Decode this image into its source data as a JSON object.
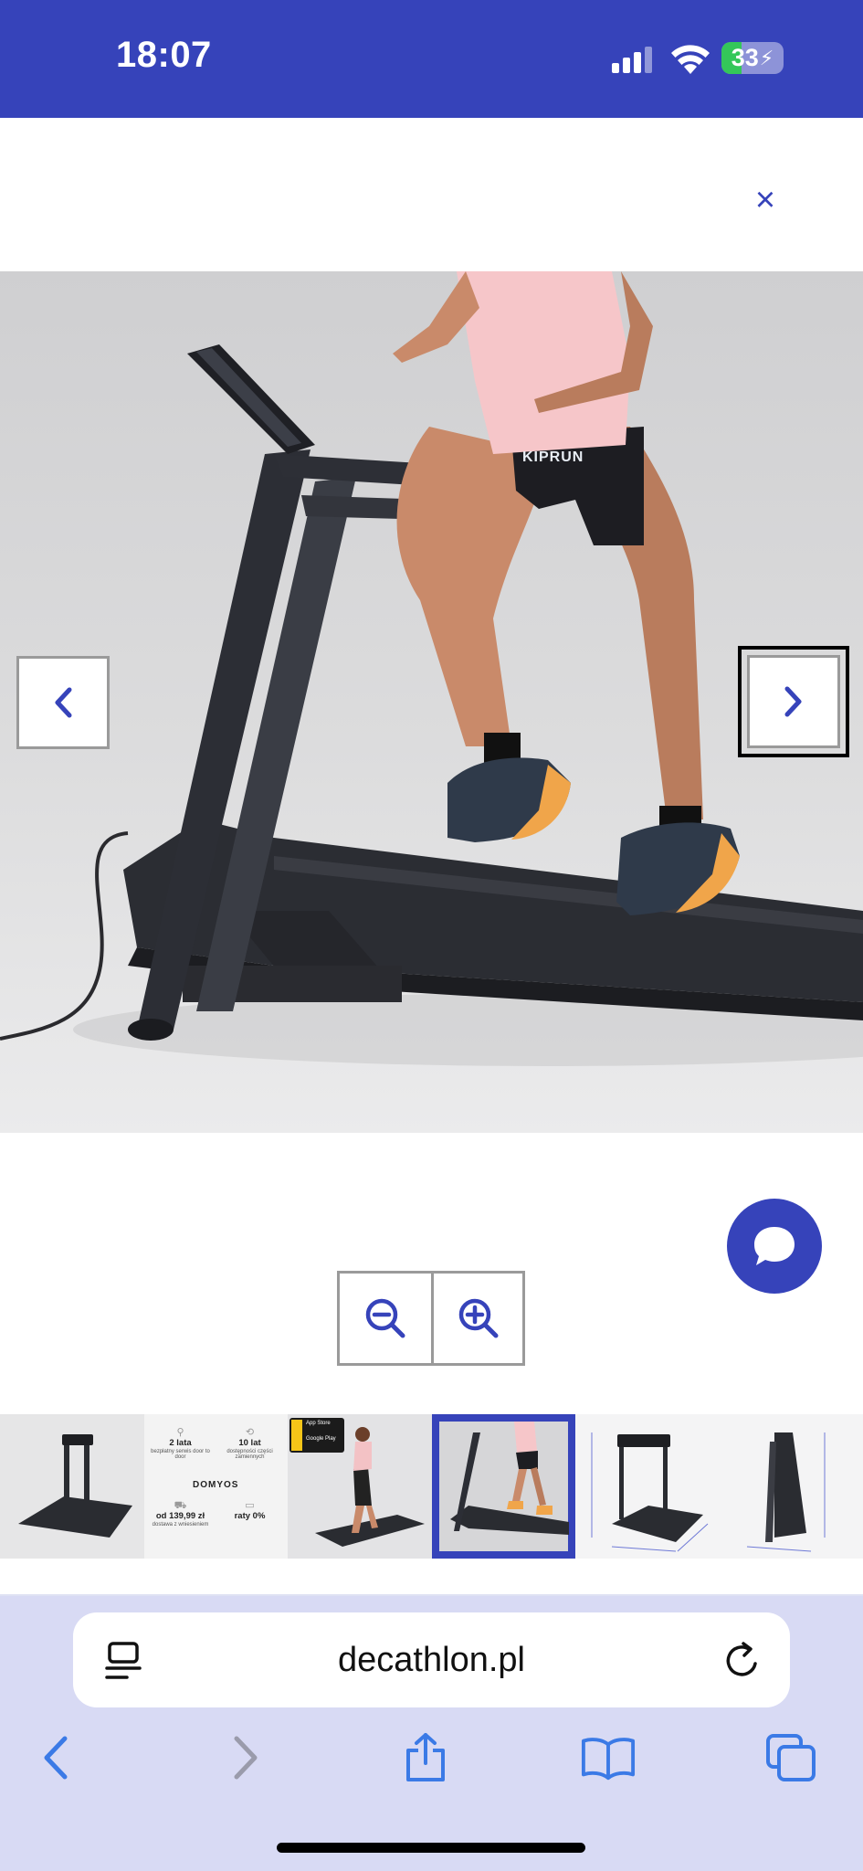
{
  "status_bar": {
    "time": "18:07",
    "battery_level": "33",
    "battery_fraction": 0.33,
    "signal_icon": "cellular-signal-icon",
    "wifi_icon": "wifi-icon",
    "charging_icon": "bolt-icon"
  },
  "modal": {
    "close_label": "×",
    "close_icon": "close-icon"
  },
  "gallery": {
    "main_image": "treadmill-runner-photo",
    "shirt_logo": "KIPRUN",
    "prev_icon": "chevron-left-icon",
    "next_icon": "chevron-right-icon",
    "zoom_out_icon": "zoom-out-icon",
    "zoom_in_icon": "zoom-in-icon",
    "active_index": 3,
    "info_thumb": {
      "warranty_value": "2 lata",
      "warranty_desc": "bezpłatny serwis door to door",
      "parts_value": "10 lat",
      "parts_desc": "dostępności części zamiennych",
      "brand": "DOMYOS",
      "price_value": "od 139,99 zł",
      "price_desc": "dostawa z wniesieniem",
      "installments_value": "raty 0%",
      "store_badge_1": "App Store",
      "store_badge_2": "Google Play"
    }
  },
  "chat": {
    "icon": "chat-bubble-icon"
  },
  "browser": {
    "url": "decathlon.pl",
    "tabs_icon": "tab-list-icon",
    "reload_icon": "reload-icon",
    "back_icon": "back-arrow-icon",
    "forward_icon": "forward-arrow-icon",
    "share_icon": "share-icon",
    "bookmarks_icon": "book-icon",
    "tabs_overview_icon": "tabs-icon"
  },
  "colors": {
    "brand": "#3643ba",
    "browser_bg": "#d8daf4",
    "battery_green": "#34c759"
  }
}
